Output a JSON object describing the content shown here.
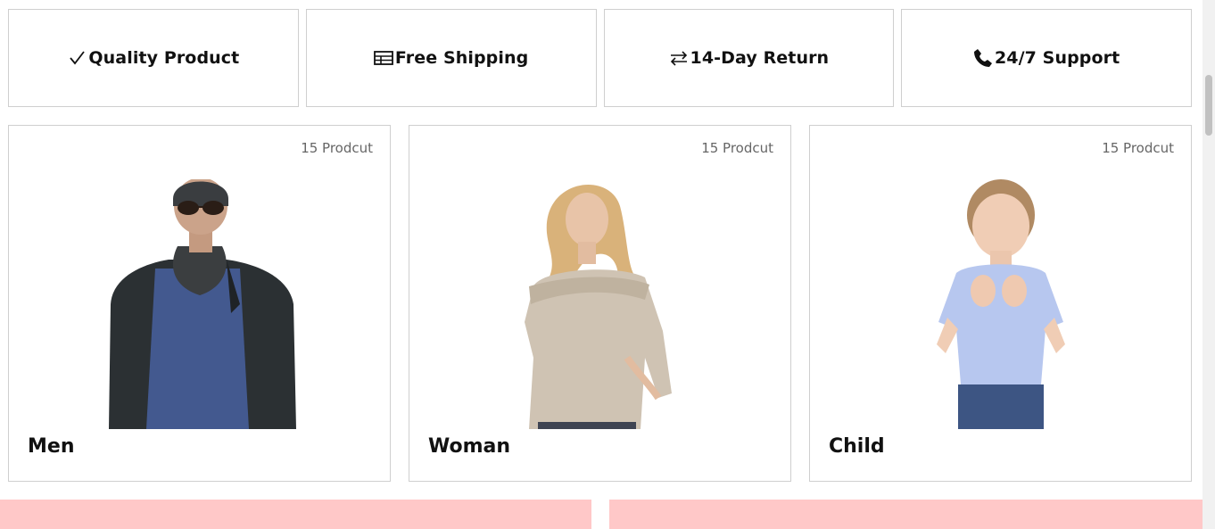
{
  "features": [
    {
      "icon": "check-icon",
      "label": "Quality Product"
    },
    {
      "icon": "shipping-icon",
      "label": "Free Shipping"
    },
    {
      "icon": "return-arrows-icon",
      "label": "14-Day Return"
    },
    {
      "icon": "phone-icon",
      "label": "24/7 Support"
    }
  ],
  "categories": [
    {
      "name": "Men",
      "count": "15 Prodcut"
    },
    {
      "name": "Woman",
      "count": "15 Prodcut"
    },
    {
      "name": "Child",
      "count": "15 Prodcut"
    }
  ],
  "colors": {
    "border": "#cfcfcf",
    "banner": "#ffc8c8",
    "text": "#111111",
    "muted": "#666666"
  }
}
